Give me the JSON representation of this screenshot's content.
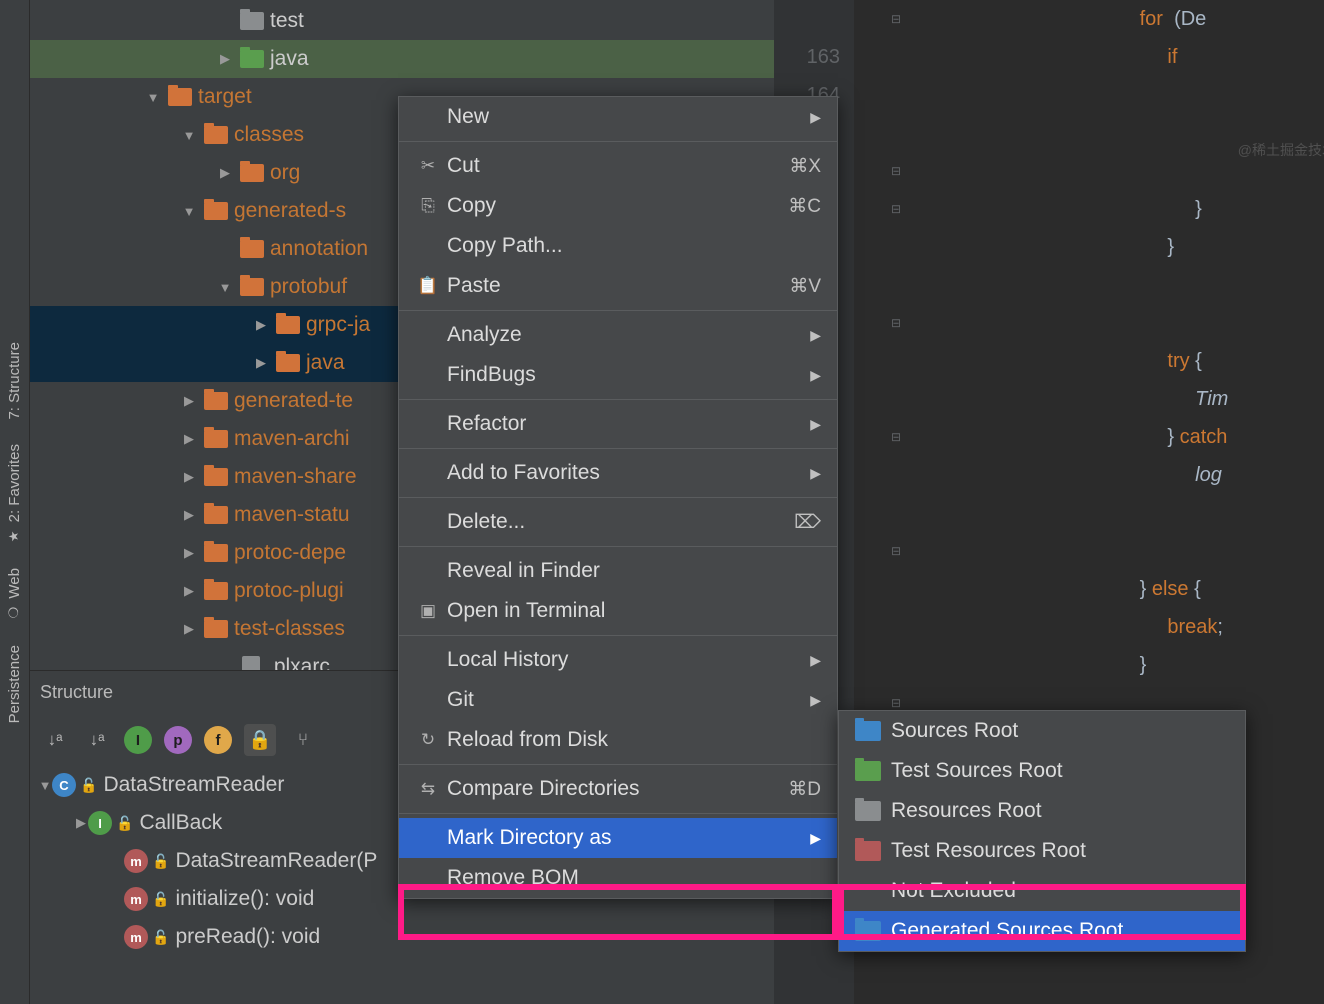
{
  "rail": {
    "structure": "7: Structure",
    "favorites": "2: Favorites",
    "web": "Web",
    "persistence": "Persistence"
  },
  "tree": [
    {
      "indent": 5,
      "arrow": "",
      "type": "grey",
      "label": "test",
      "cls": "white"
    },
    {
      "indent": 5,
      "arrow": "▶",
      "type": "green",
      "label": "java",
      "cls": "white",
      "sel": "green"
    },
    {
      "indent": 3,
      "arrow": "▼",
      "type": "orange",
      "label": "target"
    },
    {
      "indent": 4,
      "arrow": "▼",
      "type": "orange",
      "label": "classes"
    },
    {
      "indent": 5,
      "arrow": "▶",
      "type": "orange",
      "label": "org"
    },
    {
      "indent": 4,
      "arrow": "▼",
      "type": "orange",
      "label": "generated-s"
    },
    {
      "indent": 5,
      "arrow": "",
      "type": "orange",
      "label": "annotation"
    },
    {
      "indent": 5,
      "arrow": "▼",
      "type": "orange",
      "label": "protobuf"
    },
    {
      "indent": 6,
      "arrow": "▶",
      "type": "orange",
      "label": "grpc-ja",
      "sel": "blue"
    },
    {
      "indent": 6,
      "arrow": "▶",
      "type": "orange",
      "label": "java",
      "sel": "blue"
    },
    {
      "indent": 4,
      "arrow": "▶",
      "type": "orange",
      "label": "generated-te"
    },
    {
      "indent": 4,
      "arrow": "▶",
      "type": "orange",
      "label": "maven-archi"
    },
    {
      "indent": 4,
      "arrow": "▶",
      "type": "orange",
      "label": "maven-share"
    },
    {
      "indent": 4,
      "arrow": "▶",
      "type": "orange",
      "label": "maven-statu"
    },
    {
      "indent": 4,
      "arrow": "▶",
      "type": "orange",
      "label": "protoc-depe"
    },
    {
      "indent": 4,
      "arrow": "▶",
      "type": "orange",
      "label": "protoc-plugi"
    },
    {
      "indent": 4,
      "arrow": "▶",
      "type": "orange",
      "label": "test-classes"
    },
    {
      "indent": 5,
      "arrow": "",
      "type": "file",
      "label": ".plxarc",
      "cls": "white"
    }
  ],
  "structure": {
    "title": "Structure",
    "items": [
      {
        "indent": 0,
        "arrow": "▼",
        "badge": "C",
        "bcls": "sc",
        "label": "DataStreamReader"
      },
      {
        "indent": 1,
        "arrow": "▶",
        "badge": "I",
        "bcls": "si",
        "label": "CallBack"
      },
      {
        "indent": 2,
        "arrow": "",
        "badge": "m",
        "bcls": "sm",
        "label": "DataStreamReader(P"
      },
      {
        "indent": 2,
        "arrow": "",
        "badge": "m",
        "bcls": "sm",
        "label": "initialize(): void"
      },
      {
        "indent": 2,
        "arrow": "",
        "badge": "m",
        "bcls": "sm",
        "label": "preRead(): void"
      }
    ]
  },
  "gutter": [
    "",
    "163",
    "164",
    "",
    "",
    "",
    "",
    "",
    "",
    "",
    "",
    "",
    "",
    "",
    "",
    "",
    "",
    "",
    "",
    "",
    "",
    "",
    "",
    "",
    "",
    ""
  ],
  "code": [
    "                                     for  (De",
    "                                          if",
    "",
    "",
    "",
    "                                               }",
    "                                          }",
    "",
    "",
    "                                          try {",
    "                                               Tim",
    "                                          } catch",
    "                                               log",
    "",
    "",
    "                                     } else {",
    "                                          break;",
    "                                     }",
    ""
  ],
  "menu": [
    {
      "lbl": "New",
      "arrow": true
    },
    {
      "sep": true
    },
    {
      "icon": "✂",
      "lbl": "Cut",
      "sc": "⌘X"
    },
    {
      "icon": "⎘",
      "lbl": "Copy",
      "sc": "⌘C"
    },
    {
      "lbl": "Copy Path..."
    },
    {
      "icon": "📋",
      "lbl": "Paste",
      "sc": "⌘V"
    },
    {
      "sep": true
    },
    {
      "lbl": "Analyze",
      "arrow": true
    },
    {
      "lbl": "FindBugs",
      "arrow": true
    },
    {
      "sep": true
    },
    {
      "lbl": "Refactor",
      "arrow": true
    },
    {
      "sep": true
    },
    {
      "lbl": "Add to Favorites",
      "arrow": true
    },
    {
      "sep": true
    },
    {
      "lbl": "Delete...",
      "sc": "⌦"
    },
    {
      "sep": true
    },
    {
      "lbl": "Reveal in Finder"
    },
    {
      "icon": "▣",
      "lbl": "Open in Terminal"
    },
    {
      "sep": true
    },
    {
      "lbl": "Local History",
      "arrow": true
    },
    {
      "lbl": "Git",
      "arrow": true
    },
    {
      "icon": "↻",
      "lbl": "Reload from Disk"
    },
    {
      "sep": true
    },
    {
      "icon": "⇆",
      "lbl": "Compare Directories",
      "sc": "⌘D"
    },
    {
      "sep": true
    },
    {
      "lbl": "Mark Directory as",
      "arrow": true,
      "sel": true
    },
    {
      "lbl": "Remove BOM"
    }
  ],
  "submenu": [
    {
      "icon": "ic-blue",
      "lbl": "Sources Root"
    },
    {
      "icon": "ic-green",
      "lbl": "Test Sources Root"
    },
    {
      "icon": "ic-res",
      "lbl": "Resources Root"
    },
    {
      "icon": "ic-tres",
      "lbl": "Test Resources Root"
    },
    {
      "lbl": "Not Excluded"
    },
    {
      "icon": "ic-gen",
      "lbl": "Generated Sources Root",
      "sel": true
    }
  ]
}
